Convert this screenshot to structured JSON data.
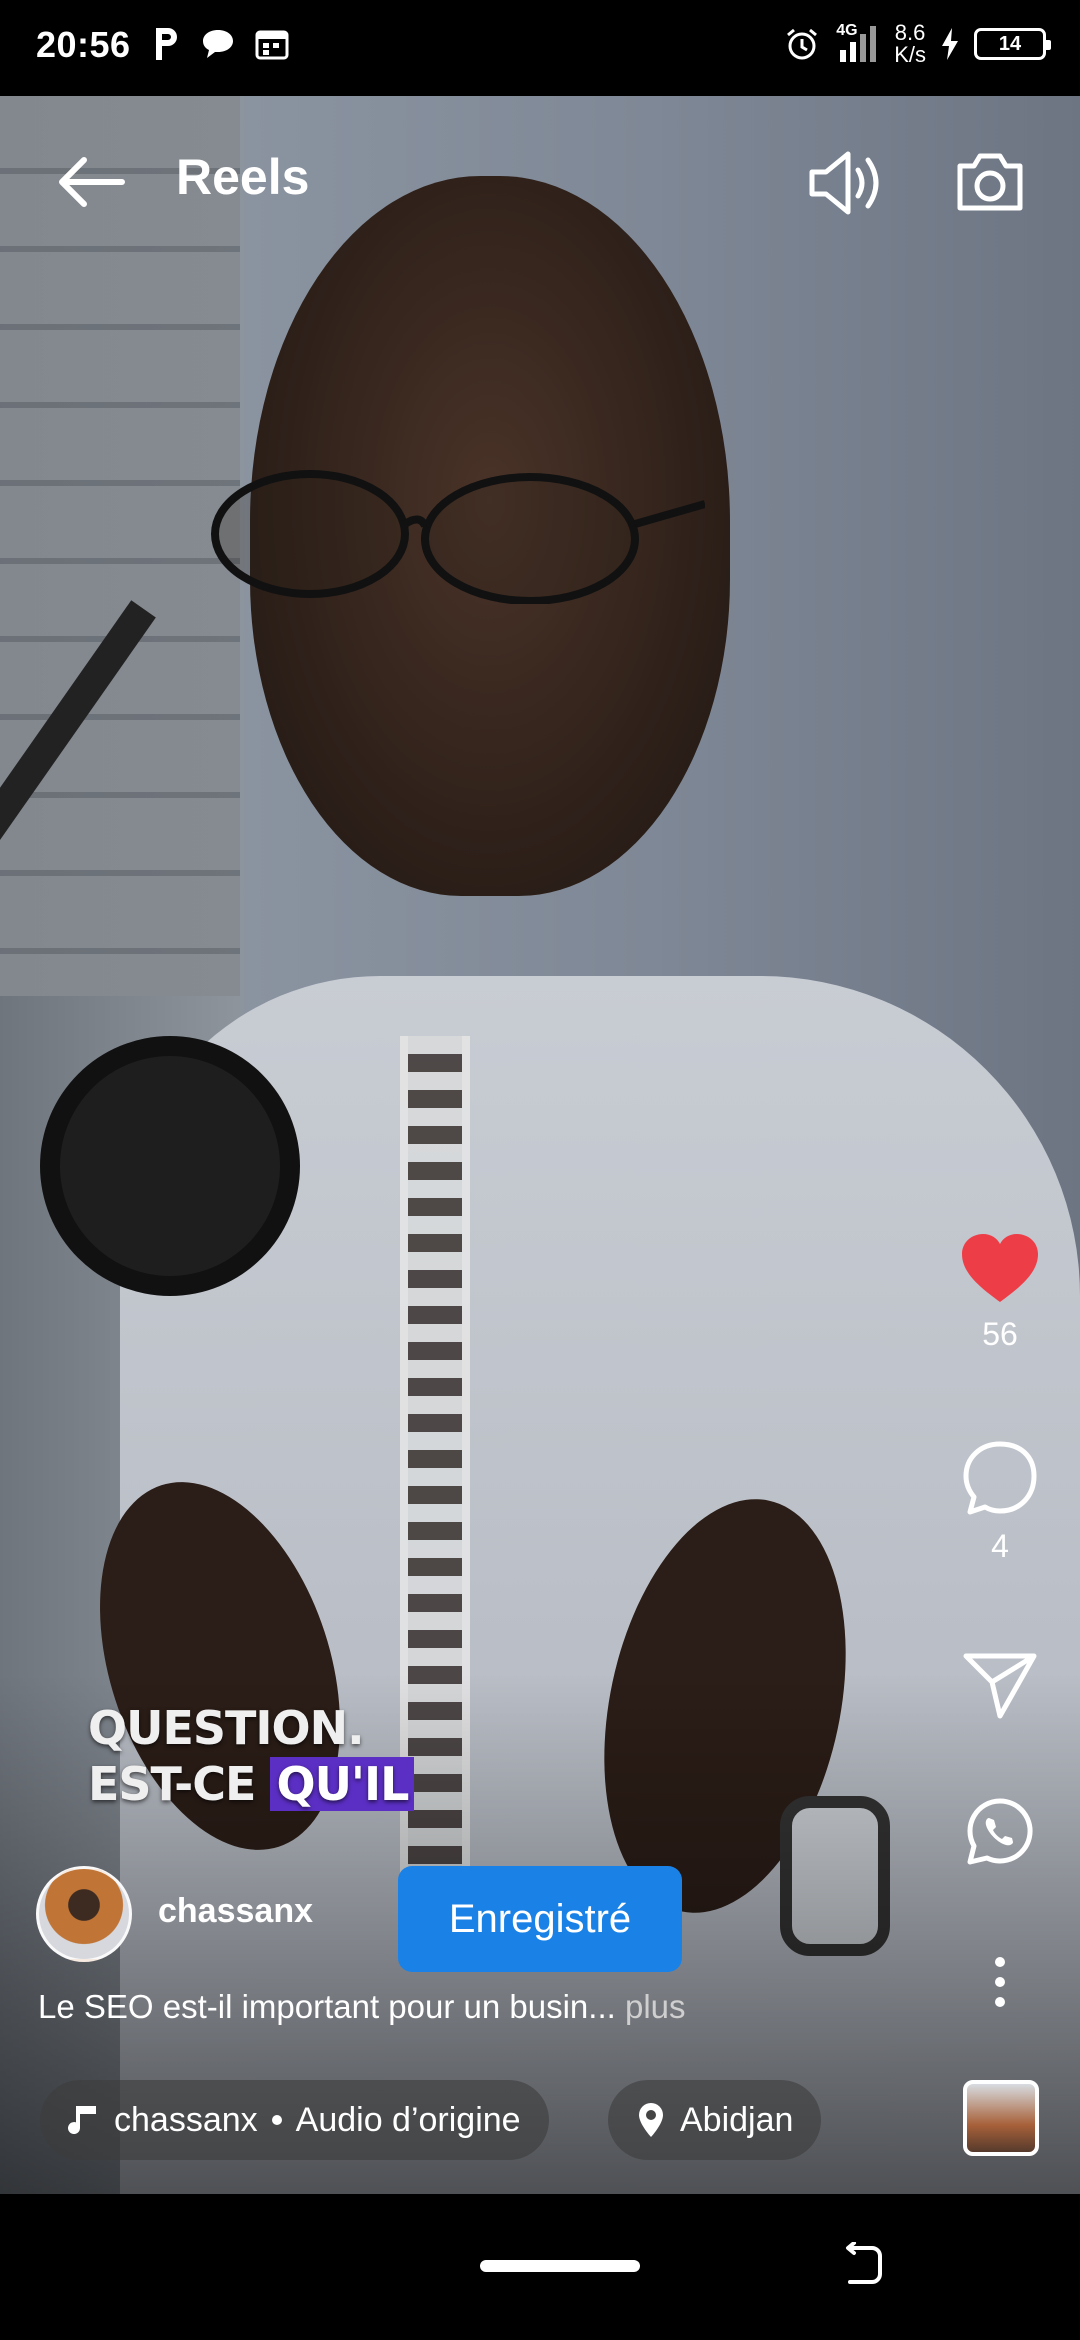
{
  "status_bar": {
    "time": "20:56",
    "network": "4G",
    "speed_value": "8.6",
    "speed_unit": "K/s",
    "battery": "14"
  },
  "header": {
    "title": "Reels"
  },
  "video_caption": {
    "line1": "QUESTION.",
    "line2_plain": "EST-CE",
    "line2_highlight": "QU'IL"
  },
  "actions": {
    "likes": "56",
    "comments": "4"
  },
  "author": {
    "username": "chassanx",
    "follow_button": "Enregistré"
  },
  "description": {
    "text": "Le SEO est-il important pour un busin...",
    "more": "plus"
  },
  "audio": {
    "artist": "chassanx",
    "track": "Audio d’origine"
  },
  "location": {
    "name": "Abidjan"
  },
  "colors": {
    "like_heart": "#ed3e48",
    "follow_button": "#1a82e6",
    "caption_highlight": "#5b2fc4"
  }
}
